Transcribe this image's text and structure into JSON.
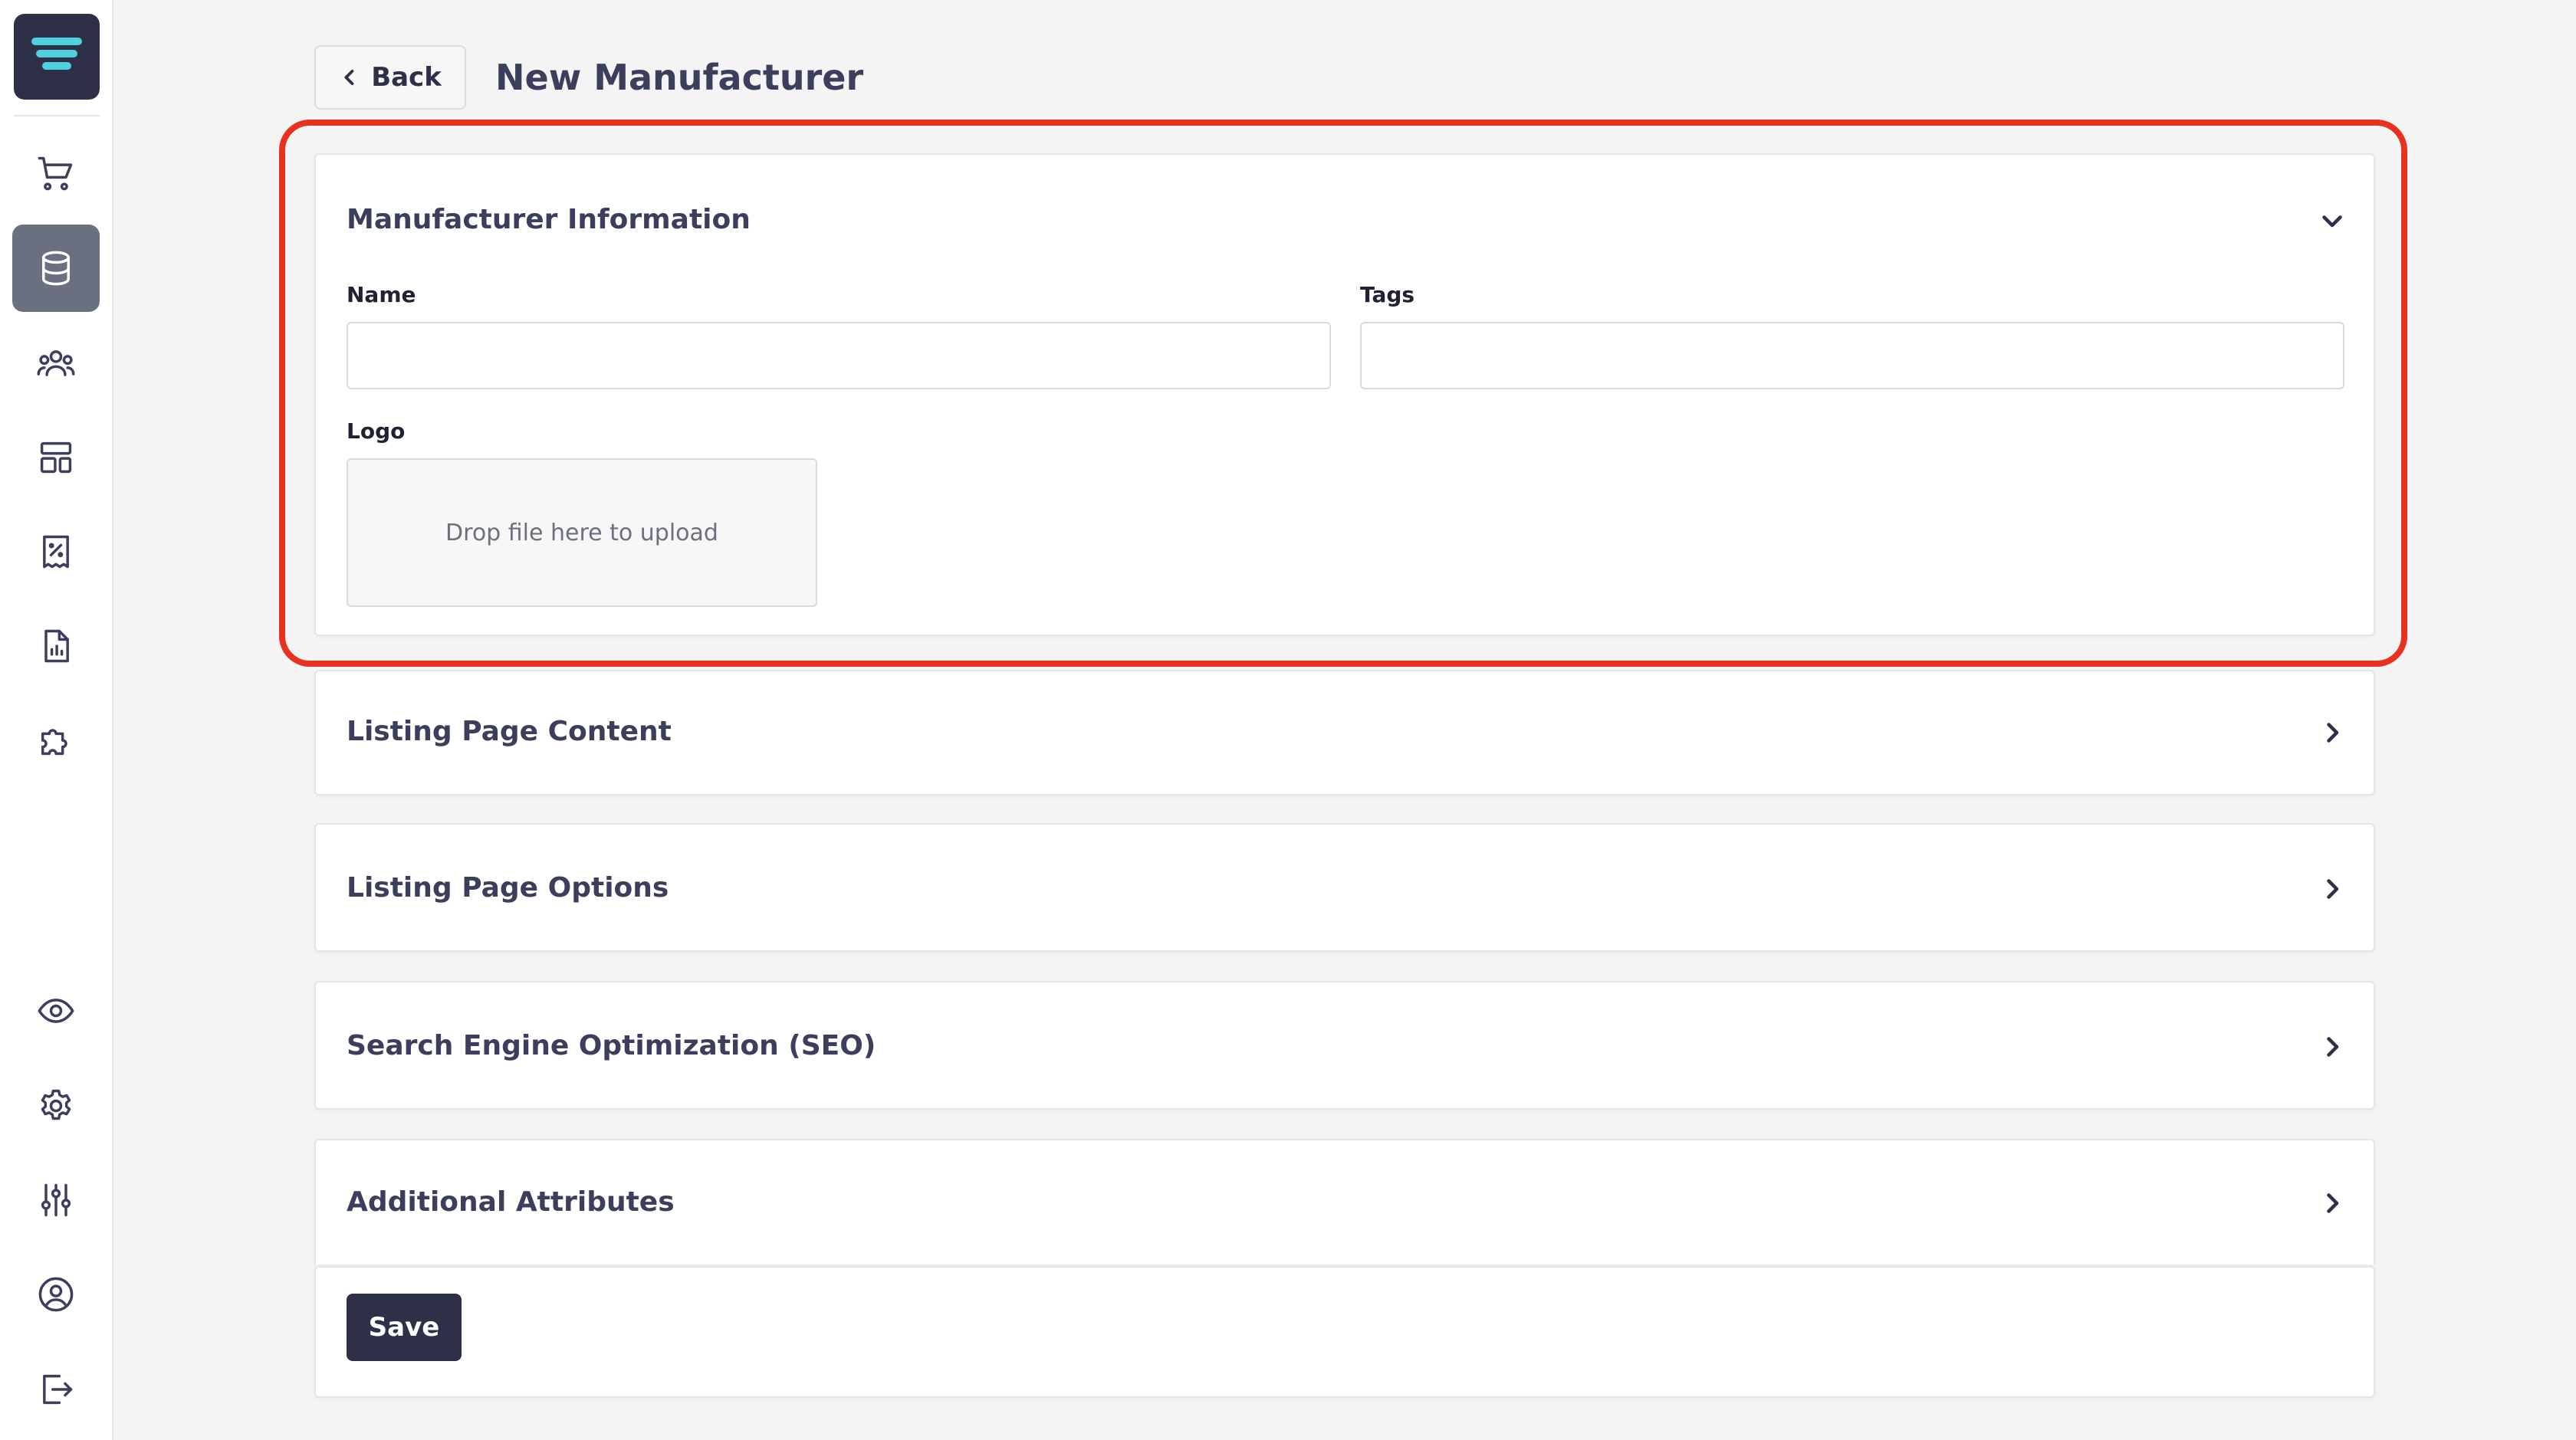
{
  "header": {
    "back_label": "Back",
    "title": "New Manufacturer"
  },
  "sidebar": {
    "top_items": [
      {
        "name": "cart"
      },
      {
        "name": "database",
        "active": true
      },
      {
        "name": "users"
      },
      {
        "name": "layout"
      },
      {
        "name": "receipt-discount"
      },
      {
        "name": "report"
      },
      {
        "name": "puzzle"
      }
    ],
    "bottom_items": [
      {
        "name": "eye"
      },
      {
        "name": "gear"
      },
      {
        "name": "sliders"
      },
      {
        "name": "user-circle"
      },
      {
        "name": "logout"
      }
    ]
  },
  "manufacturer_info": {
    "title": "Manufacturer Information",
    "name_label": "Name",
    "name_value": "",
    "tags_label": "Tags",
    "tags_value": "",
    "logo_label": "Logo",
    "dropzone_text": "Drop file here to upload"
  },
  "sections": [
    {
      "title": "Listing Page Content"
    },
    {
      "title": "Listing Page Options"
    },
    {
      "title": "Search Engine Optimization (SEO)"
    },
    {
      "title": "Additional Attributes"
    }
  ],
  "footer": {
    "save_label": "Save"
  },
  "colors": {
    "primary": "#2d3047",
    "highlight": "#e8321f",
    "active_nav": "#6b7080"
  }
}
